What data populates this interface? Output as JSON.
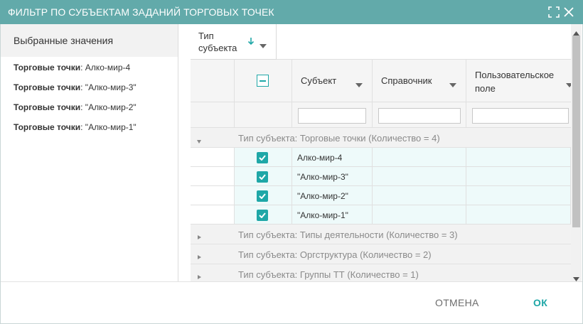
{
  "dialog": {
    "title": "ФИЛЬТР ПО СУБЪЕКТАМ ЗАДАНИЙ ТОРГОВЫХ ТОЧЕК",
    "accent_color": "#62aaaa",
    "check_color": "#1fa7a7"
  },
  "left": {
    "header": "Выбранные значения",
    "items": [
      {
        "label": "Торговые точки",
        "value": ": Алко-мир-4"
      },
      {
        "label": "Торговые точки",
        "value": ": \"Алко-мир-3\""
      },
      {
        "label": "Торговые точки",
        "value": ": \"Алко-мир-2\""
      },
      {
        "label": "Торговые точки",
        "value": ": \"Алко-мир-1\""
      }
    ]
  },
  "grid": {
    "group_chip": {
      "line1": "Тип",
      "line2": "субъекта"
    },
    "columns": {
      "subject": "Субъект",
      "reference": "Справочник",
      "user_field_1": "Пользовательское",
      "user_field_2": "поле"
    },
    "groups": [
      {
        "text": "Тип субъекта: Торговые точки (Количество = 4)",
        "expanded": true
      },
      {
        "text": "Тип субъекта: Типы деятельности (Количество = 3)",
        "expanded": false
      },
      {
        "text": "Тип субъекта: Оргструктура (Количество = 2)",
        "expanded": false
      },
      {
        "text": "Тип субъекта: Группы ТТ (Количество = 1)",
        "expanded": false
      }
    ],
    "rows": [
      {
        "subject": "Алко-мир-4",
        "checked": true
      },
      {
        "subject": "\"Алко-мир-3\"",
        "checked": true
      },
      {
        "subject": "\"Алко-мир-2\"",
        "checked": true
      },
      {
        "subject": "\"Алко-мир-1\"",
        "checked": true
      }
    ]
  },
  "footer": {
    "cancel": "ОТМЕНА",
    "ok": "ОК"
  }
}
